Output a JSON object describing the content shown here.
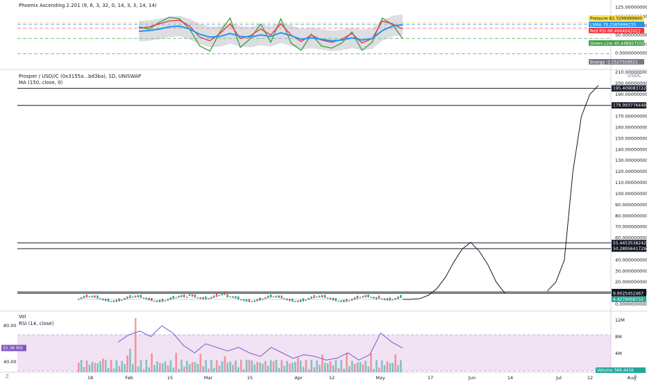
{
  "indicator_pane": {
    "title": "Phoenix Ascending 2.201 (9, 6, 3, 32, 0, 14, 3, 3, 14, 14)",
    "ticks": [
      "125.0000000000",
      "100.0000000000",
      "75.0000000000",
      "50.0000000000",
      "25.0000000000",
      "0.0000000000"
    ],
    "levels": [
      {
        "label": "Pressure",
        "value": "82.3299999900",
        "color": "#f7e04f"
      },
      {
        "label": "LSMA",
        "value": "78.2585999235",
        "color": "#2196f3"
      },
      {
        "label": "Red RSI",
        "value": "68.4644042022",
        "color": "#f23645"
      },
      {
        "label": "Green Line",
        "value": "40.4489271029",
        "color": "#43a047"
      },
      {
        "label": "Energy",
        "value": "-1.1527316521",
        "color": "#787b86"
      }
    ]
  },
  "price_pane": {
    "title": "Prosper / USD//C (0x3155a...bd3ba), 1D, UNISWAP",
    "subtitle": "MA (150, close, 0)",
    "unit": "USDC",
    "ticks": [
      "210.0000000000",
      "200.0000000000",
      "190.0000000000",
      "180.0000000000",
      "170.0000000000",
      "160.0000000000",
      "150.0000000000",
      "140.0000000000",
      "130.0000000000",
      "120.0000000000",
      "110.0000000000",
      "100.0000000000",
      "90.0000000000",
      "80.0000000000",
      "70.0000000000",
      "60.0000000000",
      "50.0000000000",
      "40.0000000000",
      "30.0000000000",
      "20.0000000000",
      "10.0000000000",
      "0.0000000000"
    ],
    "hlines": [
      "195.4090837226",
      "179.9937764487",
      "55.4453538242",
      "50.2895641729",
      "11.0482762800",
      "9.9025452467"
    ],
    "last_price": "4.4279458732"
  },
  "volume_pane": {
    "title": "Vol",
    "subtitle": "RSI (14, close)",
    "rsi_ticks": [
      "80.00",
      "40.00"
    ],
    "rsi_value": "55.36",
    "rsi_label": "RSI",
    "vol_ticks": [
      "12M",
      "8M",
      "4M"
    ],
    "volume_label": "Volume",
    "volume_value": "349.4416"
  },
  "time_axis": {
    "labels": [
      "18",
      "Feb",
      "15",
      "Mar",
      "15",
      "Apr",
      "12",
      "May",
      "17",
      "Jun",
      "14",
      "Jul",
      "12",
      "Aug"
    ]
  },
  "bottom_bar": {
    "left": "Z",
    "right": "A"
  },
  "chart_data": [
    {
      "type": "line",
      "title": "Phoenix Ascending 2.201 (9, 6, 3, 32, 0, 14, 3, 3, 14, 14)",
      "ylim": [
        -10,
        130
      ],
      "x": [
        0,
        4,
        8,
        12,
        16,
        20,
        24,
        28,
        32,
        36,
        40,
        44,
        48,
        52,
        56,
        60,
        64,
        68,
        72,
        76,
        80,
        84,
        88,
        92,
        96,
        100,
        104
      ],
      "series": [
        {
          "name": "Green Line",
          "color": "#43a047",
          "values": [
            72,
            66,
            84,
            98,
            94,
            66,
            20,
            6,
            58,
            96,
            16,
            40,
            80,
            30,
            94,
            28,
            8,
            52,
            20,
            14,
            28,
            58,
            8,
            30,
            96,
            78,
            40
          ]
        },
        {
          "name": "Red RSI",
          "color": "#f23645",
          "values": [
            68,
            72,
            80,
            88,
            90,
            74,
            44,
            34,
            54,
            80,
            40,
            48,
            66,
            50,
            80,
            50,
            32,
            50,
            36,
            30,
            38,
            54,
            28,
            40,
            88,
            80,
            66
          ]
        },
        {
          "name": "LSMA",
          "color": "#2196f3",
          "values": [
            60,
            62,
            66,
            72,
            74,
            66,
            52,
            44,
            46,
            54,
            46,
            44,
            50,
            46,
            56,
            48,
            38,
            42,
            38,
            34,
            36,
            42,
            36,
            40,
            62,
            74,
            78
          ]
        }
      ],
      "hlines": [
        82.33,
        78.26,
        68.46,
        40.45,
        -1.15
      ]
    },
    {
      "type": "line",
      "title": "Prosper / USD//C (0x3155a...bd3ba), 1D, UNISWAP",
      "ylim": [
        0,
        210
      ],
      "x": [
        0,
        5,
        10,
        15,
        20,
        25,
        30,
        35,
        40,
        45,
        50,
        55,
        60,
        65,
        70,
        75,
        80,
        85,
        90,
        95,
        100,
        105,
        110,
        115
      ],
      "series": [
        {
          "name": "MA (150, close, 0)",
          "color": "#131722",
          "values": [
            4.4,
            4.4,
            5,
            8,
            14,
            24,
            38,
            50,
            56,
            48,
            36,
            20,
            10,
            null,
            null,
            null,
            null,
            12,
            20,
            40,
            120,
            170,
            190,
            198
          ]
        }
      ],
      "hlines": [
        195.41,
        179.99,
        55.45,
        50.29,
        11.05,
        9.9
      ]
    },
    {
      "type": "line",
      "title": "RSI (14, close)",
      "ylim": [
        30,
        90
      ],
      "x": [
        0,
        4,
        8,
        12,
        16,
        20,
        24,
        28,
        32,
        36,
        40,
        44,
        48,
        52,
        56,
        60,
        64,
        68,
        72,
        76,
        80,
        84,
        88,
        92,
        96,
        100,
        104
      ],
      "series": [
        {
          "name": "RSI",
          "color": "#7e57c2",
          "values": [
            62,
            70,
            74,
            68,
            80,
            72,
            58,
            50,
            60,
            56,
            52,
            56,
            50,
            46,
            56,
            50,
            44,
            48,
            46,
            42,
            44,
            50,
            42,
            48,
            72,
            62,
            55.36
          ]
        }
      ]
    }
  ]
}
